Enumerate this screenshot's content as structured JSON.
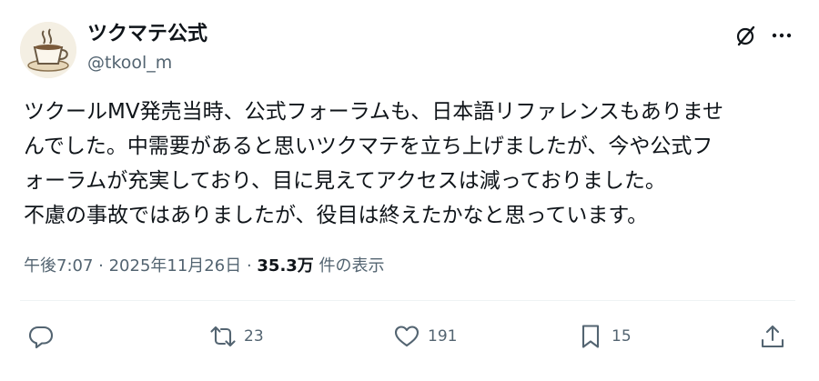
{
  "author": {
    "display_name": "ツクマテ公式",
    "handle": "@tkool_m"
  },
  "header_icons": {
    "grok": "grok-icon",
    "more": "more-icon"
  },
  "tweet": {
    "lines": [
      "ツクールMV発売当時、公式フォーラムも、日本語リファレンスもありませ",
      "んでした。中需要があると思いツクマテを立ち上げましたが、今や公式フ",
      "ォーラムが充実しており、目に見えてアクセスは減っておりました。",
      "不慮の事故ではありましたが、役目は終えたかなと思っています。"
    ]
  },
  "meta": {
    "time": "午後7:07",
    "separator1": " · ",
    "date": "2025年11月26日",
    "separator2": " · ",
    "views": "35.3万",
    "views_suffix": " 件の表示"
  },
  "actions": {
    "reply": {
      "icon": "reply-icon",
      "count": ""
    },
    "retweet": {
      "icon": "retweet-icon",
      "count": "23"
    },
    "like": {
      "icon": "heart-icon",
      "count": "191"
    },
    "bookmark": {
      "icon": "bookmark-icon",
      "count": "15"
    },
    "share": {
      "icon": "share-icon",
      "count": ""
    }
  },
  "colors": {
    "text": "#0f1419",
    "secondary": "#536471",
    "divider": "#eff3f4"
  }
}
